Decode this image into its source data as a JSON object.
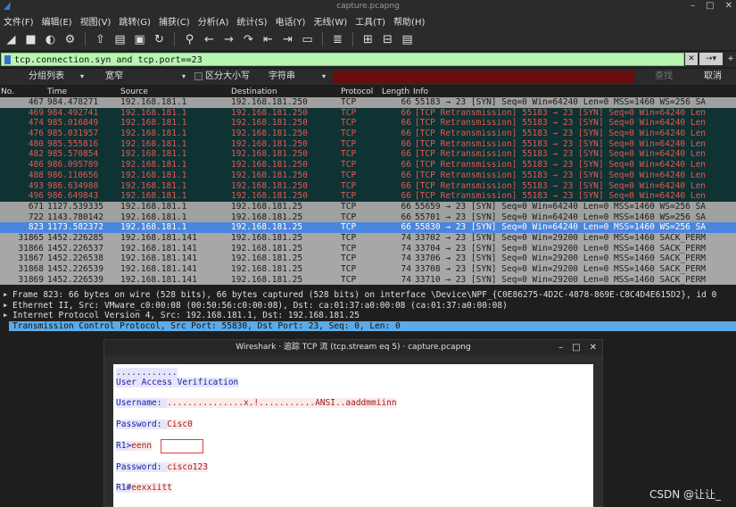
{
  "window": {
    "title": "capture.pcapng",
    "controls": [
      "–",
      "□",
      "✕"
    ]
  },
  "menu": [
    "文件(F)",
    "编辑(E)",
    "视图(V)",
    "跳转(G)",
    "捕获(C)",
    "分析(A)",
    "统计(S)",
    "电话(Y)",
    "无线(W)",
    "工具(T)",
    "帮助(H)"
  ],
  "toolbar": {
    "icons": [
      "shark-fin-start-icon",
      "stop-icon",
      "restart-icon",
      "options-gear-icon",
      "open-file-icon",
      "file-icon",
      "close-file-icon",
      "reload-icon",
      "find-icon",
      "back-icon",
      "forward-icon",
      "go-to-icon",
      "first-packet-icon",
      "last-packet-icon",
      "autoscroll-icon",
      "colorize-icon",
      "zoom-in-icon",
      "zoom-out-icon",
      "normal-size-icon"
    ],
    "glyphs": [
      "◢",
      "■",
      "◐",
      "⚙",
      "⇧",
      "▤",
      "▣",
      "↻",
      "⚲",
      "←",
      "→",
      "↷",
      "⇤",
      "⇥",
      "▭",
      "≣",
      "⊞",
      "⊟",
      "▤"
    ]
  },
  "filter": {
    "value": "tcp.connection.syn and tcp.port==23",
    "clear": "✕",
    "arrow": "→",
    "dropdown": "▾",
    "add": "+"
  },
  "search": {
    "scope": "分组列表",
    "charset": "宽窄",
    "case_label": "区分大小写",
    "type": "字符串",
    "find_button": "查找",
    "cancel_button": "取消"
  },
  "columns": [
    "No.",
    "Time",
    "Source",
    "Destination",
    "Protocol",
    "Length",
    "Info"
  ],
  "packets": [
    {
      "no": "467",
      "time": "984.478271",
      "src": "192.168.181.1",
      "dst": "192.168.181.250",
      "proto": "TCP",
      "len": "66",
      "info": "55183 → 23 [SYN] Seq=0 Win=64240 Len=0 MSS=1460 WS=256 SA",
      "style": "gray"
    },
    {
      "no": "469",
      "time": "984.492741",
      "src": "192.168.181.1",
      "dst": "192.168.181.250",
      "proto": "TCP",
      "len": "66",
      "info": "[TCP Retransmission] 55183 → 23 [SYN] Seq=0 Win=64240 Len",
      "style": "dark"
    },
    {
      "no": "474",
      "time": "985.016849",
      "src": "192.168.181.1",
      "dst": "192.168.181.250",
      "proto": "TCP",
      "len": "66",
      "info": "[TCP Retransmission] 55183 → 23 [SYN] Seq=0 Win=64240 Len",
      "style": "dark"
    },
    {
      "no": "476",
      "time": "985.031957",
      "src": "192.168.181.1",
      "dst": "192.168.181.250",
      "proto": "TCP",
      "len": "66",
      "info": "[TCP Retransmission] 55183 → 23 [SYN] Seq=0 Win=64240 Len",
      "style": "dark"
    },
    {
      "no": "480",
      "time": "985.555816",
      "src": "192.168.181.1",
      "dst": "192.168.181.250",
      "proto": "TCP",
      "len": "66",
      "info": "[TCP Retransmission] 55183 → 23 [SYN] Seq=0 Win=64240 Len",
      "style": "dark"
    },
    {
      "no": "482",
      "time": "985.570854",
      "src": "192.168.181.1",
      "dst": "192.168.181.250",
      "proto": "TCP",
      "len": "66",
      "info": "[TCP Retransmission] 55183 → 23 [SYN] Seq=0 Win=64240 Len",
      "style": "dark"
    },
    {
      "no": "486",
      "time": "986.095789",
      "src": "192.168.181.1",
      "dst": "192.168.181.250",
      "proto": "TCP",
      "len": "66",
      "info": "[TCP Retransmission] 55183 → 23 [SYN] Seq=0 Win=64240 Len",
      "style": "dark"
    },
    {
      "no": "488",
      "time": "986.110656",
      "src": "192.168.181.1",
      "dst": "192.168.181.250",
      "proto": "TCP",
      "len": "66",
      "info": "[TCP Retransmission] 55183 → 23 [SYN] Seq=0 Win=64240 Len",
      "style": "dark"
    },
    {
      "no": "493",
      "time": "986.634980",
      "src": "192.168.181.1",
      "dst": "192.168.181.250",
      "proto": "TCP",
      "len": "66",
      "info": "[TCP Retransmission] 55183 → 23 [SYN] Seq=0 Win=64240 Len",
      "style": "dark"
    },
    {
      "no": "496",
      "time": "986.649843",
      "src": "192.168.181.1",
      "dst": "192.168.181.250",
      "proto": "TCP",
      "len": "66",
      "info": "[TCP Retransmission] 55183 → 23 [SYN] Seq=0 Win=64240 Len",
      "style": "dark"
    },
    {
      "no": "671",
      "time": "1127.539335",
      "src": "192.168.181.1",
      "dst": "192.168.181.25",
      "proto": "TCP",
      "len": "66",
      "info": "55659 → 23 [SYN] Seq=0 Win=64240 Len=0 MSS=1460 WS=256 SA",
      "style": "gray"
    },
    {
      "no": "722",
      "time": "1143.780142",
      "src": "192.168.181.1",
      "dst": "192.168.181.25",
      "proto": "TCP",
      "len": "66",
      "info": "55701 → 23 [SYN] Seq=0 Win=64240 Len=0 MSS=1460 WS=256 SA",
      "style": "gray"
    },
    {
      "no": "823",
      "time": "1173.582372",
      "src": "192.168.181.1",
      "dst": "192.168.181.25",
      "proto": "TCP",
      "len": "66",
      "info": "55830 → 23 [SYN] Seq=0 Win=64240 Len=0 MSS=1460 WS=256 SA",
      "style": "sel-row"
    },
    {
      "no": "31865",
      "time": "1452.226285",
      "src": "192.168.181.141",
      "dst": "192.168.181.25",
      "proto": "TCP",
      "len": "74",
      "info": "33702 → 23 [SYN] Seq=0 Win=29200 Len=0 MSS=1460 SACK_PERM",
      "style": "light"
    },
    {
      "no": "31866",
      "time": "1452.226537",
      "src": "192.168.181.141",
      "dst": "192.168.181.25",
      "proto": "TCP",
      "len": "74",
      "info": "33704 → 23 [SYN] Seq=0 Win=29200 Len=0 MSS=1460 SACK_PERM",
      "style": "light"
    },
    {
      "no": "31867",
      "time": "1452.226538",
      "src": "192.168.181.141",
      "dst": "192.168.181.25",
      "proto": "TCP",
      "len": "74",
      "info": "33706 → 23 [SYN] Seq=0 Win=29200 Len=0 MSS=1460 SACK_PERM",
      "style": "light"
    },
    {
      "no": "31868",
      "time": "1452.226539",
      "src": "192.168.181.141",
      "dst": "192.168.181.25",
      "proto": "TCP",
      "len": "74",
      "info": "33708 → 23 [SYN] Seq=0 Win=29200 Len=0 MSS=1460 SACK_PERM",
      "style": "light"
    },
    {
      "no": "31869",
      "time": "1452.226539",
      "src": "192.168.181.141",
      "dst": "192.168.181.25",
      "proto": "TCP",
      "len": "74",
      "info": "33710 → 23 [SYN] Seq=0 Win=29200 Len=0 MSS=1460 SACK_PERM",
      "style": "light"
    }
  ],
  "details": [
    "Frame 823: 66 bytes on wire (528 bits), 66 bytes captured (528 bits) on interface \\Device\\NPF_{C0E86275-4D2C-4878-869E-C8C4D4E615D2}, id 0",
    "Ethernet II, Src: VMware_c0:00:08 (00:50:56:c0:00:08), Dst: ca:01:37:a0:00:08 (ca:01:37:a0:00:08)",
    "Internet Protocol Version 4, Src: 192.168.181.1, Dst: 192.168.181.25",
    "Transmission Control Protocol, Src Port: 55830, Dst Port: 23, Seq: 0, Len: 0"
  ],
  "dialog": {
    "title": "Wireshark · 追踪 TCP 流 (tcp.stream eq 5) · capture.pcapng",
    "controls": [
      "–",
      "□",
      "✕"
    ],
    "lines": [
      {
        "text": "............",
        "kind": "server"
      },
      {
        "text": "User Access Verification",
        "kind": "server"
      },
      {
        "text": "Username: ...............x.!...........ANSI..aaddmmiinn",
        "kind": "mixed",
        "server_part": "Username: ",
        "client_part": "...............x.!...........ANSI..aaddmmiinn"
      },
      {
        "text": "Password: Cisc0",
        "kind": "mixed",
        "server_part": "Password: ",
        "client_part": "Cisc0"
      },
      {
        "text": "R1>eenn",
        "kind": "mixed",
        "server_part": "R1>",
        "client_part": "eenn"
      },
      {
        "text": "Password: cisco123",
        "kind": "mixed",
        "server_part": "Password: ",
        "client_part": "cisco123"
      },
      {
        "text": "R1#eexxiitt",
        "kind": "mixed",
        "server_part": "R1#",
        "client_part": "eexxiitt"
      }
    ]
  },
  "watermark": "CSDN @让让_"
}
